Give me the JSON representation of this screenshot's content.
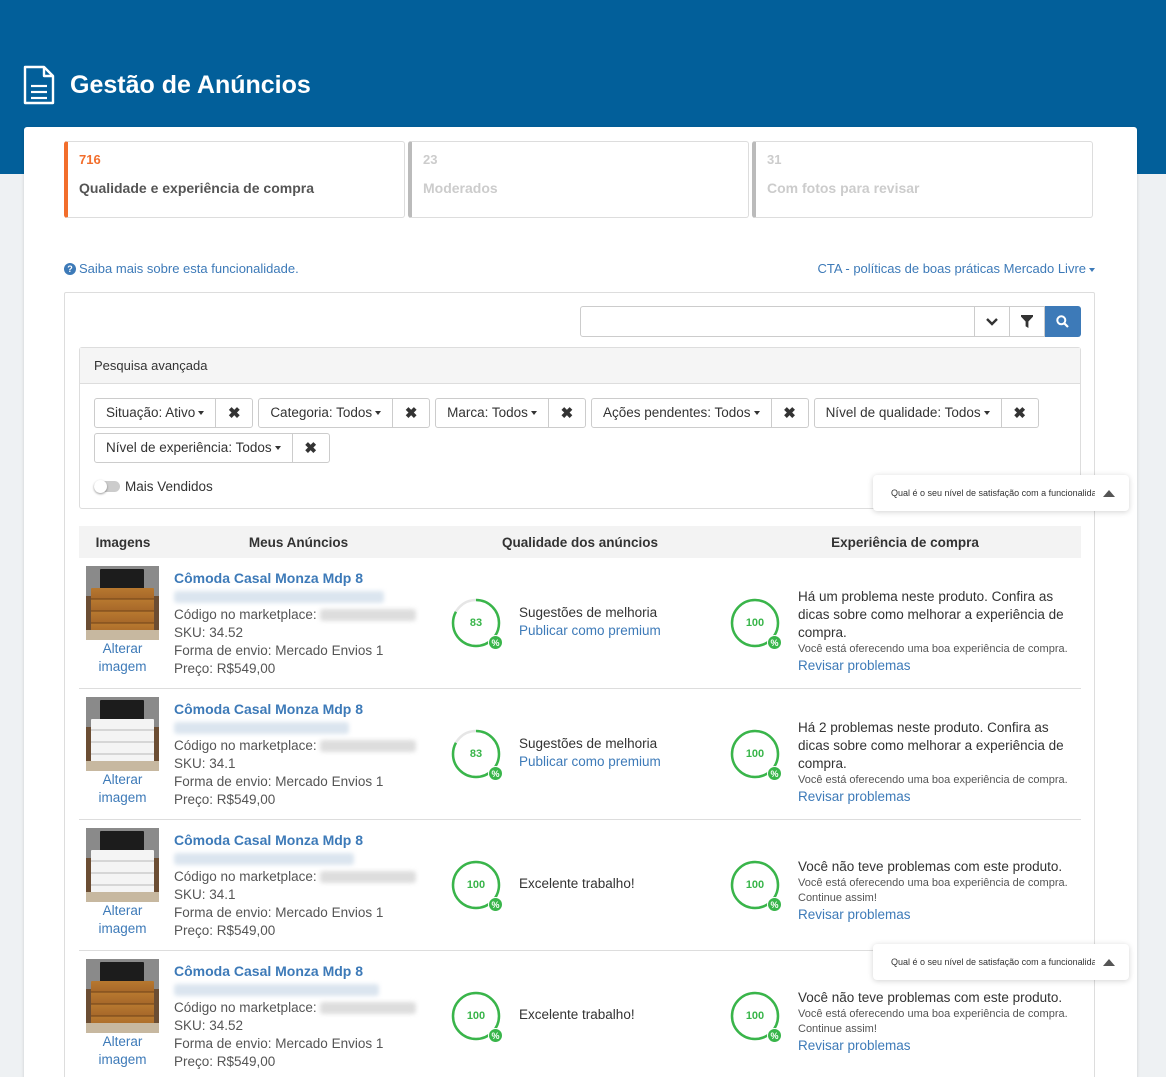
{
  "header": {
    "title": "Gestão de Anúncios",
    "icon": "document-icon",
    "bg_color": "#025f9a"
  },
  "tabs": [
    {
      "count": "716",
      "label": "Qualidade e experiência de compra",
      "active": true
    },
    {
      "count": "23",
      "label": "Moderados",
      "active": false
    },
    {
      "count": "31",
      "label": "Com fotos para revisar",
      "active": false
    }
  ],
  "links": {
    "info": "Saiba mais sobre esta funcionalidade.",
    "cta": "CTA - políticas de boas práticas Mercado Livre"
  },
  "search": {
    "placeholder": "",
    "value": ""
  },
  "advanced": {
    "title": "Pesquisa avançada",
    "filters": [
      "Situação: Ativo",
      "Categoria: Todos",
      "Marca: Todos",
      "Ações pendentes: Todos",
      "Nível de qualidade: Todos",
      "Nível de experiência: Todos"
    ],
    "toggle_label": "Mais Vendidos"
  },
  "table": {
    "headers": [
      "Imagens",
      "Meus Anúncios",
      "Qualidade dos anúncios",
      "Experiência de compra"
    ],
    "rows": [
      {
        "image_alt": "Alterar imagem",
        "image_style": "wood",
        "title": "Cômoda Casal Monza Mdp 8",
        "code_label": "Código no marketplace:",
        "sku": "SKU: 34.52",
        "shipping": "Forma de envio: Mercado Envios 1",
        "price": "Preço: R$549,00",
        "quality_score": "83",
        "quality_title": "Sugestões de melhoria",
        "quality_link": "Publicar como premium",
        "exp_score": "100",
        "exp_title": "Há um problema neste produto. Confira as dicas sobre como melhorar a experiência de compra.",
        "exp_small": "Você está oferecendo uma boa experiência de compra.",
        "exp_link": "Revisar problemas"
      },
      {
        "image_alt": "Alterar imagem",
        "image_style": "white",
        "title": "Cômoda Casal Monza Mdp 8",
        "code_label": "Código no marketplace:",
        "sku": "SKU: 34.1",
        "shipping": "Forma de envio: Mercado Envios 1",
        "price": "Preço: R$549,00",
        "quality_score": "83",
        "quality_title": "Sugestões de melhoria",
        "quality_link": "Publicar como premium",
        "exp_score": "100",
        "exp_title": "Há 2 problemas neste produto. Confira as dicas sobre como melhorar a experiência de compra.",
        "exp_small": "Você está oferecendo uma boa experiência de compra.",
        "exp_link": "Revisar problemas"
      },
      {
        "image_alt": "Alterar imagem",
        "image_style": "white",
        "title": "Cômoda Casal Monza Mdp 8",
        "code_label": "Código no marketplace:",
        "sku": "SKU: 34.1",
        "shipping": "Forma de envio: Mercado Envios 1",
        "price": "Preço: R$549,00",
        "quality_score": "100",
        "quality_title": "Excelente trabalho!",
        "quality_link": "",
        "exp_score": "100",
        "exp_title": "Você não teve problemas com este produto.",
        "exp_small": "Você está oferecendo uma boa experiência de compra. Continue assim!",
        "exp_link": "Revisar problemas"
      },
      {
        "image_alt": "Alterar imagem",
        "image_style": "wood",
        "title": "Cômoda Casal Monza Mdp 8",
        "code_label": "Código no marketplace:",
        "sku": "SKU: 34.52",
        "shipping": "Forma de envio: Mercado Envios 1",
        "price": "Preço: R$549,00",
        "quality_score": "100",
        "quality_title": "Excelente trabalho!",
        "quality_link": "",
        "exp_score": "100",
        "exp_title": "Você não teve problemas com este produto.",
        "exp_small": "Você está oferecendo uma boa experiência de compra. Continue assim!",
        "exp_link": "Revisar problemas"
      }
    ]
  },
  "satisfaction": {
    "label": "Qual é o seu nível de satisfação com a funcionalidade..."
  },
  "colors": {
    "accent": "#f26e2c",
    "link": "#3d7ab8",
    "success": "#39b54a"
  }
}
